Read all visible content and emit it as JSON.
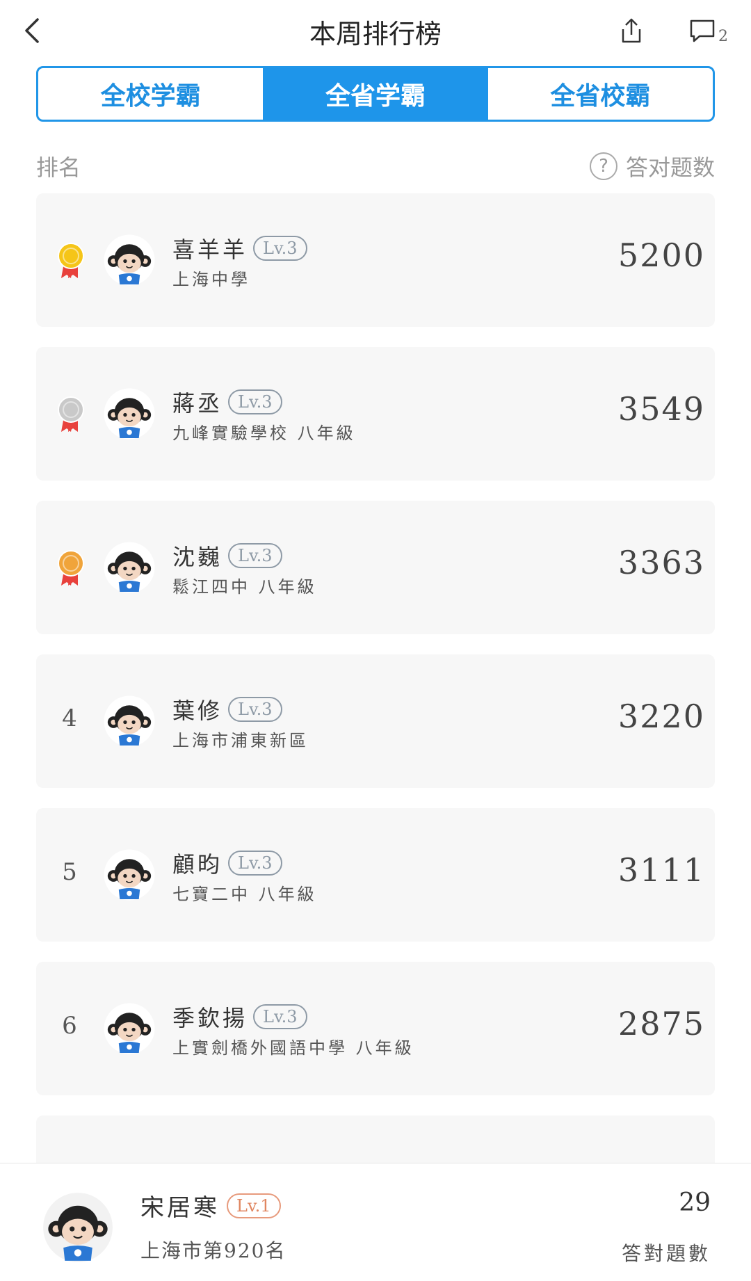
{
  "header": {
    "title": "本周排行榜",
    "comment_count": "2"
  },
  "tabs": [
    {
      "label": "全校学霸",
      "active": false
    },
    {
      "label": "全省学霸",
      "active": true
    },
    {
      "label": "全省校霸",
      "active": false
    }
  ],
  "columns": {
    "rank": "排名",
    "count": "答对题数"
  },
  "rows": [
    {
      "rank": "",
      "medal": "gold",
      "name": "喜羊羊",
      "level": "Lv.3",
      "school": "上海中學",
      "score": "5200"
    },
    {
      "rank": "",
      "medal": "silver",
      "name": "蔣丞",
      "level": "Lv.3",
      "school": "九峰實驗學校 八年級",
      "score": "3549"
    },
    {
      "rank": "",
      "medal": "bronze",
      "name": "沈巍",
      "level": "Lv.3",
      "school": "鬆江四中 八年級",
      "score": "3363"
    },
    {
      "rank": "4",
      "medal": "",
      "name": "葉修",
      "level": "Lv.3",
      "school": "上海市浦東新區",
      "score": "3220"
    },
    {
      "rank": "5",
      "medal": "",
      "name": "顧昀",
      "level": "Lv.3",
      "school": "七寶二中 八年級",
      "score": "3111"
    },
    {
      "rank": "6",
      "medal": "",
      "name": "季欽揚",
      "level": "Lv.3",
      "school": "上實劍橋外國語中學 八年級",
      "score": "2875"
    }
  ],
  "self": {
    "name": "宋居寒",
    "level": "Lv.1",
    "rank_text": "上海市第920名",
    "score": "29",
    "score_label": "答對題數"
  },
  "colors": {
    "accent": "#1e95ea",
    "gold": "#f5c518",
    "silver": "#c9c9c9",
    "bronze": "#f0a43a",
    "ribbon": "#e8413c"
  }
}
